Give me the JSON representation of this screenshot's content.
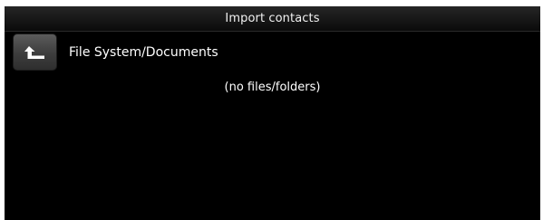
{
  "window": {
    "title": "Import contacts"
  },
  "browser": {
    "up_icon": "up-arrow-icon",
    "current_path": "File System/Documents",
    "empty_message": "(no files/folders)"
  }
}
